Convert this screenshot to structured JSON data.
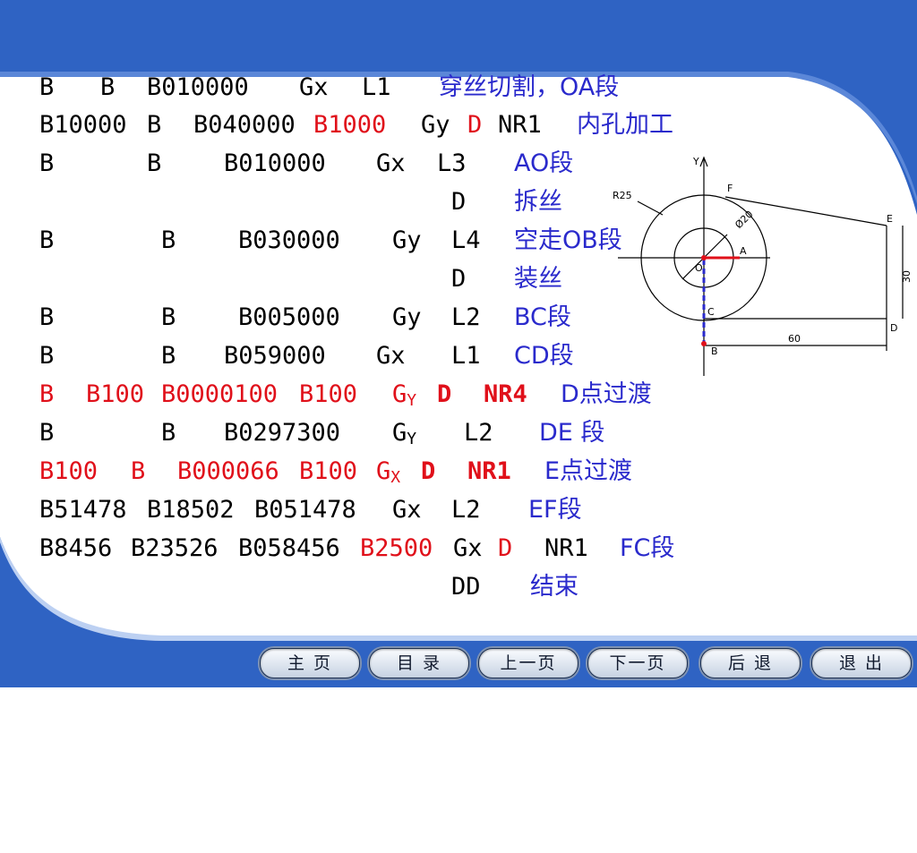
{
  "colors": {
    "header_blue": "#2f63c3",
    "text_black": "#000000",
    "text_red": "#e0101a",
    "text_blue": "#2a2acc"
  },
  "lines": [
    [
      "B",
      "B",
      "B010000",
      "Gx",
      "L1",
      "穿丝切割，OA段"
    ],
    [
      "B10000",
      "B",
      "B040000",
      "B1000",
      "Gy",
      "D",
      "NR1",
      "内孔加工"
    ],
    [
      "B",
      "B",
      "B010000",
      "Gx",
      "L3",
      "AO段"
    ],
    [
      "D",
      "拆丝"
    ],
    [
      "B",
      "B",
      "B030000",
      "Gy",
      "L4",
      "空走OB段"
    ],
    [
      "D",
      "装丝"
    ],
    [
      "B",
      "B",
      "B005000",
      "Gy",
      "L2",
      "BC段"
    ],
    [
      "B",
      "B",
      "B059000",
      "Gx",
      "L1",
      "CD段"
    ],
    [
      "B",
      "B100",
      "B0000100",
      "B100",
      "G",
      "Y",
      "D",
      "NR4",
      "D点过渡"
    ],
    [
      "B",
      "B",
      "B0297300",
      "G",
      "Y",
      "L2",
      "DE 段"
    ],
    [
      "B100",
      "B",
      "B000066",
      "B100",
      "G",
      "X",
      "D",
      "NR1",
      "E点过渡"
    ],
    [
      "B51478",
      "B18502",
      "B051478",
      "Gx",
      "L2",
      "EF段"
    ],
    [
      "B8456",
      "B23526",
      "B058456",
      "B2500",
      "Gx",
      "D",
      "NR1",
      "FC段"
    ],
    [
      "DD",
      "结束"
    ]
  ],
  "figure": {
    "labels": [
      "Y",
      "R25",
      "F",
      "Ø20",
      "A",
      "E",
      "O",
      "C",
      "30",
      "D",
      "60",
      "B"
    ]
  },
  "nav": {
    "home": "主 页",
    "contents": "目 录",
    "prev": "上一页",
    "next": "下一页",
    "back": "后 退",
    "exit": "退 出"
  }
}
